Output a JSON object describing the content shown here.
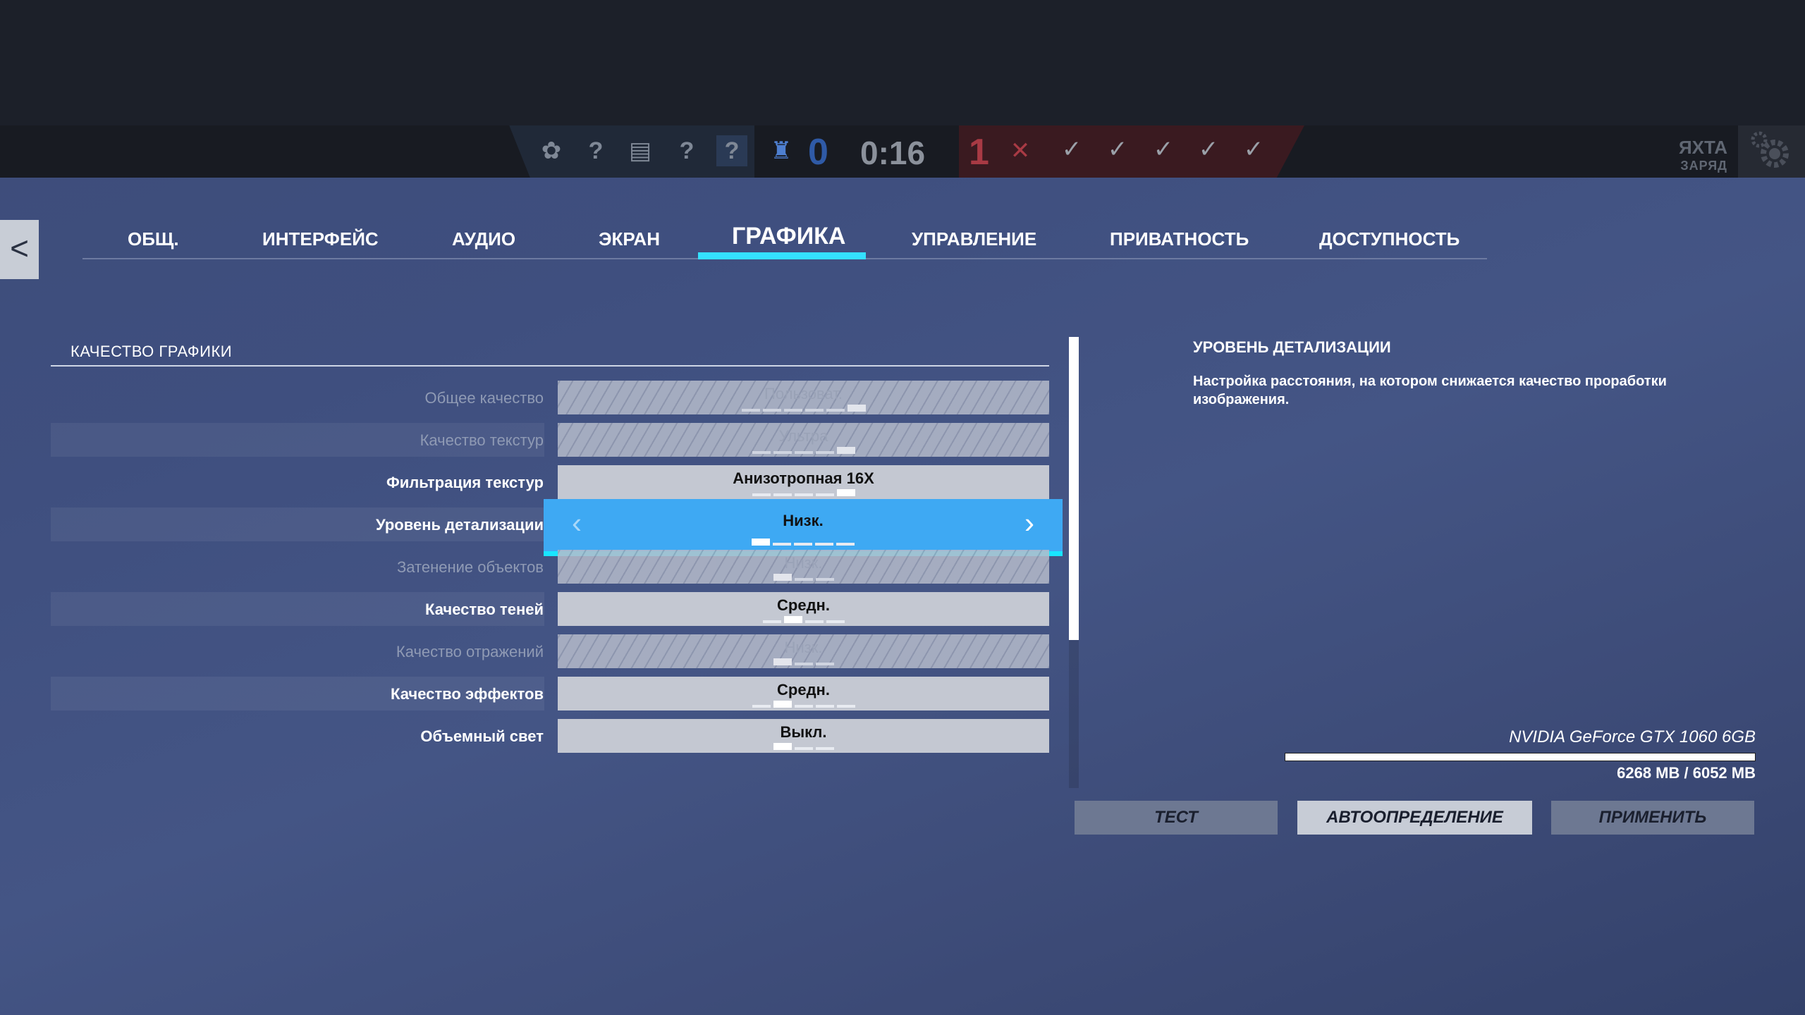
{
  "hud": {
    "timer": "0:16",
    "blue_score": "0",
    "red_score": "1",
    "blue_ops": [
      "?",
      "?",
      "?"
    ],
    "red_checks": [
      "✓",
      "✓",
      "✓",
      "✓",
      "✓"
    ],
    "map_name": "ЯХТА",
    "mode": "ЗАРЯД"
  },
  "nav": {
    "back": "<",
    "tabs": [
      "ОБЩ.",
      "ИНТЕРФЕЙС",
      "АУДИО",
      "ЭКРАН",
      "ГРАФИКА",
      "УПРАВЛЕНИЕ",
      "ПРИВАТНОСТЬ",
      "ДОСТУПНОСТЬ"
    ],
    "active_tab": "ГРАФИКА"
  },
  "section": {
    "title": "КАЧЕСТВО ГРАФИКИ",
    "rows": [
      {
        "label": "Общее качество",
        "value": "Пользоват.",
        "disabled": true,
        "levels": 6,
        "level": 6
      },
      {
        "label": "Качество текстур",
        "value": "Ультра",
        "disabled": true,
        "levels": 5,
        "level": 5
      },
      {
        "label": "Фильтрация текстур",
        "value": "Анизотропная 16X",
        "disabled": false,
        "levels": 5,
        "level": 5
      },
      {
        "label": "Уровень детализации",
        "value": "Низк.",
        "disabled": false,
        "levels": 5,
        "level": 1,
        "selected": true
      },
      {
        "label": "Затенение объектов",
        "value": "Низк.",
        "disabled": true,
        "levels": 3,
        "level": 1
      },
      {
        "label": "Качество теней",
        "value": "Средн.",
        "disabled": false,
        "levels": 4,
        "level": 2
      },
      {
        "label": "Качество отражений",
        "value": "Низк.",
        "disabled": true,
        "levels": 3,
        "level": 1
      },
      {
        "label": "Качество эффектов",
        "value": "Средн.",
        "disabled": false,
        "levels": 5,
        "level": 2
      },
      {
        "label": "Объемный свет",
        "value": "Выкл.",
        "disabled": false,
        "levels": 3,
        "level": 1
      }
    ]
  },
  "description": {
    "title": "УРОВЕНЬ ДЕТАЛИЗАЦИИ",
    "text": "Настройка расстояния, на котором снижается качество проработки изображения."
  },
  "gpu": {
    "name": "NVIDIA GeForce GTX 1060 6GB",
    "memory": "6268 MB / 6052 MB",
    "usage_fraction": 1.0
  },
  "buttons": {
    "test": "ТЕСТ",
    "auto": "АВТООПРЕДЕЛЕНИЕ",
    "apply": "ПРИМЕНИТЬ"
  }
}
